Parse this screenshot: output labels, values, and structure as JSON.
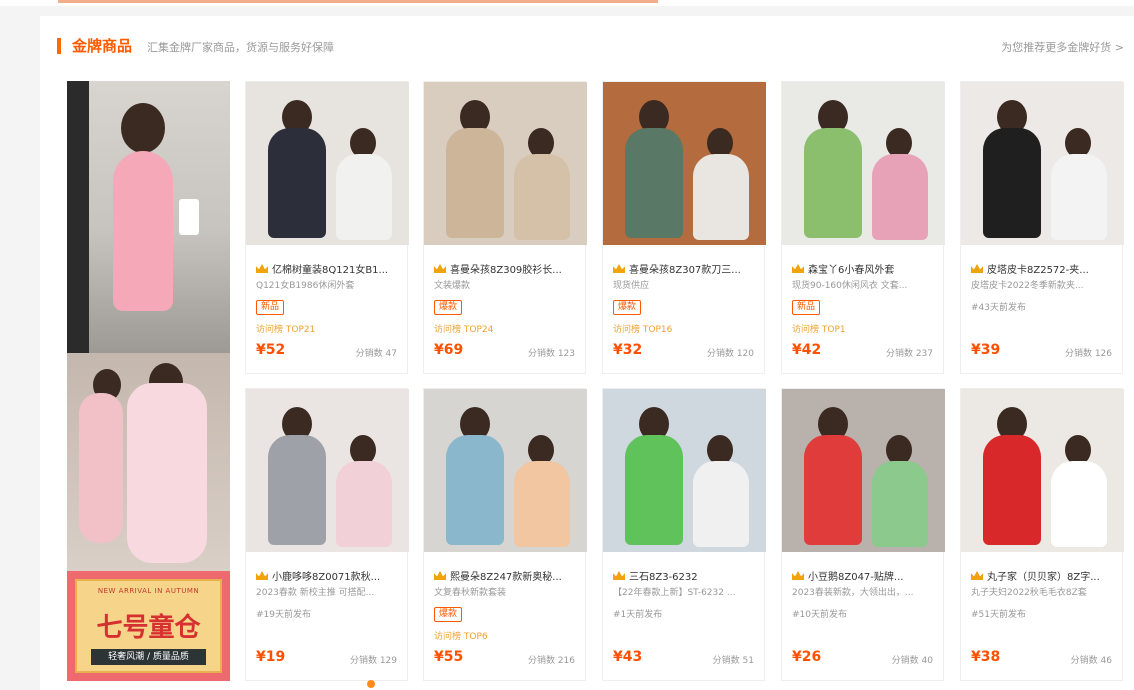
{
  "section": {
    "title": "金牌商品",
    "subtitle": "汇集金牌厂家商品，货源与服务好保障",
    "more_link": "为您推荐更多金牌好货 >"
  },
  "banner": {
    "store_arc": "NEW ARRIVAL IN AUTUMN",
    "store_name": "七号童仓",
    "store_tag": "轻奢风潮 / 质量品质"
  },
  "products": [
    {
      "title": "亿棉树童装8Q121女B1...",
      "desc": "Q121女B1986休闲外套",
      "badge": "新品",
      "visits": "访问榜 TOP21",
      "price": "¥52",
      "dist": "分销数 47",
      "colors": {
        "bg": "#e7e3df",
        "fig": "#2c2f3a",
        "fig2": "#f1f1ef"
      }
    },
    {
      "title": "喜曼朵孩8Z309胶衫长...",
      "desc": "文装爆款",
      "badge": "爆款",
      "visits": "访问榜 TOP24",
      "price": "¥69",
      "dist": "分销数 123",
      "colors": {
        "bg": "#d9cdbf",
        "fig": "#cdb59a",
        "fig2": "#d4c1a8"
      }
    },
    {
      "title": "喜曼朵孩8Z307款刀三...",
      "desc": "现货供应",
      "badge": "爆款",
      "visits": "访问榜 TOP16",
      "price": "¥32",
      "dist": "分销数 120",
      "colors": {
        "bg": "#b46b3e",
        "fig": "#5a7866",
        "fig2": "#e9e6e1"
      }
    },
    {
      "title": "森宝丫6小春风外套",
      "desc": "现货90-160休闲风衣 文套...",
      "badge": "新品",
      "visits": "访问榜 TOP1",
      "price": "¥42",
      "dist": "分销数 237",
      "colors": {
        "bg": "#e9eae6",
        "fig": "#8bbf6e",
        "fig2": "#e7a2b8"
      }
    },
    {
      "title": "皮塔皮卡8Z2572-夹...",
      "desc": "皮塔皮卡2022冬季新款夹...",
      "badge": "",
      "visits": "",
      "price": "¥39",
      "dist": "分销数 126",
      "extra": "#43天前发布",
      "colors": {
        "bg": "#ece9e6",
        "fig": "#1f1f1f",
        "fig2": "#f3f3f3"
      }
    },
    {
      "title": "小鹿哆哆8Z0071款秋...",
      "desc": "2023春款 新校主推 可搭配...",
      "badge": "",
      "visits": "",
      "price": "¥19",
      "dist": "分销数 129",
      "extra": "#19天前发布",
      "colors": {
        "bg": "#eae5e3",
        "fig": "#9ea2a8",
        "fig2": "#f2d0d8"
      }
    },
    {
      "title": "熙曼朵8Z247款新奥秘...",
      "desc": "文复春秋新款套装",
      "badge": "爆款",
      "visits": "访问榜 TOP6",
      "price": "¥55",
      "dist": "分销数 216",
      "colors": {
        "bg": "#d7d5d2",
        "fig": "#8bb7cc",
        "fig2": "#f1c6a0"
      }
    },
    {
      "title": "三石8Z3-6232",
      "desc": "【22年春款上新】ST-6232 ...",
      "badge": "",
      "visits": "",
      "price": "¥43",
      "dist": "分销数 51",
      "extra": "#1天前发布",
      "colors": {
        "bg": "#cfd8df",
        "fig": "#5fc25a",
        "fig2": "#f0f0f0"
      }
    },
    {
      "title": "小豆鹅8Z047-贴牌...",
      "desc": "2023春装新款，大领出出，...",
      "badge": "",
      "visits": "",
      "price": "¥26",
      "dist": "分销数 40",
      "extra": "#10天前发布",
      "colors": {
        "bg": "#b9b2ac",
        "fig": "#e03c3c",
        "fig2": "#8cc98c"
      }
    },
    {
      "title": "丸子家（贝贝家）8Z字...",
      "desc": "丸子夫妇2022秋毛毛衣8Z套",
      "badge": "",
      "visits": "",
      "price": "¥38",
      "dist": "分销数 46",
      "extra": "#51天前发布",
      "colors": {
        "bg": "#ece8e4",
        "fig": "#d9282a",
        "fig2": "#ffffff"
      }
    }
  ]
}
